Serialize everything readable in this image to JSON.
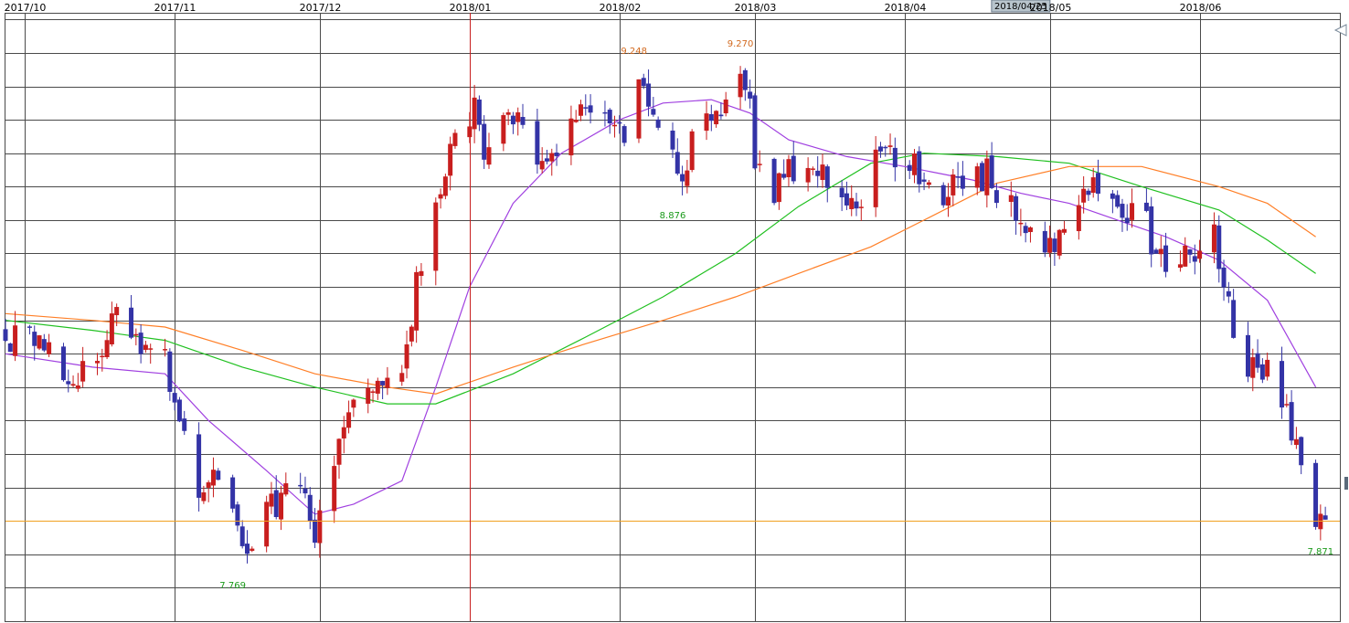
{
  "chart_data": {
    "type": "candlestick",
    "months": [
      {
        "label": "2017/10",
        "date": "2017-10-01"
      },
      {
        "label": "2017/11",
        "date": "2017-11-01"
      },
      {
        "label": "2017/12",
        "date": "2017-12-01"
      },
      {
        "label": "2018/01",
        "date": "2018-01-01"
      },
      {
        "label": "2018/02",
        "date": "2018-02-01"
      },
      {
        "label": "2018/03",
        "date": "2018-03-01"
      },
      {
        "label": "2018/04",
        "date": "2018-04-01"
      },
      {
        "label": "2018/05",
        "date": "2018-05-01"
      },
      {
        "label": "2018/06",
        "date": "2018-06-01"
      }
    ],
    "cursor_date_label": "2018/04/25",
    "x_range": [
      "2017-09-27",
      "2018-06-30"
    ],
    "y_range": [
      7.6,
      9.42
    ],
    "current_price": 7.9,
    "annotations": [
      {
        "text": "9.248",
        "date": "2018-02-04",
        "value": 9.248,
        "kind": "high"
      },
      {
        "text": "9.270",
        "date": "2018-02-26",
        "value": 9.27,
        "kind": "high"
      },
      {
        "text": "8.876",
        "date": "2018-02-12",
        "value": 8.876,
        "kind": "low"
      },
      {
        "text": "7.769",
        "date": "2017-11-13",
        "value": 7.769,
        "kind": "low"
      },
      {
        "text": "7.871",
        "date": "2018-06-26",
        "value": 7.871,
        "kind": "low"
      }
    ],
    "anchors": [
      [
        "2017-09-27",
        8.46
      ],
      [
        "2017-10-05",
        8.42
      ],
      [
        "2017-10-12",
        8.32
      ],
      [
        "2017-10-17",
        8.43
      ],
      [
        "2017-10-20",
        8.5
      ],
      [
        "2017-10-26",
        8.4
      ],
      [
        "2017-10-30",
        8.38
      ],
      [
        "2017-11-02",
        8.19
      ],
      [
        "2017-11-06",
        8.0
      ],
      [
        "2017-11-09",
        8.03
      ],
      [
        "2017-11-13",
        7.9
      ],
      [
        "2017-11-16",
        7.81
      ],
      [
        "2017-11-20",
        7.93
      ],
      [
        "2017-11-24",
        7.97
      ],
      [
        "2017-11-28",
        7.98
      ],
      [
        "2017-11-30",
        7.87
      ],
      [
        "2017-12-04",
        8.08
      ],
      [
        "2017-12-08",
        8.25
      ],
      [
        "2017-12-13",
        8.34
      ],
      [
        "2017-12-19",
        8.38
      ],
      [
        "2017-12-21",
        8.6
      ],
      [
        "2017-12-26",
        8.87
      ],
      [
        "2017-12-28",
        8.98
      ],
      [
        "2018-01-02",
        9.15
      ],
      [
        "2018-01-04",
        8.98
      ],
      [
        "2018-01-09",
        9.12
      ],
      [
        "2018-01-12",
        9.1
      ],
      [
        "2018-01-15",
        8.94
      ],
      [
        "2018-01-19",
        9.0
      ],
      [
        "2018-01-24",
        9.14
      ],
      [
        "2018-01-30",
        9.13
      ],
      [
        "2018-02-02",
        9.05
      ],
      [
        "2018-02-05",
        9.2
      ],
      [
        "2018-02-08",
        9.1
      ],
      [
        "2018-02-13",
        8.93
      ],
      [
        "2018-02-16",
        9.03
      ],
      [
        "2018-02-21",
        9.12
      ],
      [
        "2018-02-26",
        9.22
      ],
      [
        "2018-02-28",
        9.15
      ],
      [
        "2018-03-01",
        9.0
      ],
      [
        "2018-03-05",
        8.88
      ],
      [
        "2018-03-09",
        8.95
      ],
      [
        "2018-03-14",
        8.98
      ],
      [
        "2018-03-19",
        8.87
      ],
      [
        "2018-03-22",
        8.85
      ],
      [
        "2018-03-27",
        9.0
      ],
      [
        "2018-03-30",
        8.96
      ],
      [
        "2018-04-03",
        8.96
      ],
      [
        "2018-04-06",
        8.88
      ],
      [
        "2018-04-10",
        8.88
      ],
      [
        "2018-04-13",
        8.9
      ],
      [
        "2018-04-18",
        8.94
      ],
      [
        "2018-04-20",
        8.88
      ],
      [
        "2018-04-24",
        8.82
      ],
      [
        "2018-04-27",
        8.74
      ],
      [
        "2018-05-02",
        8.72
      ],
      [
        "2018-05-06",
        8.8
      ],
      [
        "2018-05-09",
        8.9
      ],
      [
        "2018-05-12",
        8.85
      ],
      [
        "2018-05-16",
        8.78
      ],
      [
        "2018-05-20",
        8.83
      ],
      [
        "2018-05-23",
        8.7
      ],
      [
        "2018-05-28",
        8.68
      ],
      [
        "2018-06-04",
        8.75
      ],
      [
        "2018-06-08",
        8.45
      ],
      [
        "2018-06-12",
        8.35
      ],
      [
        "2018-06-17",
        8.32
      ],
      [
        "2018-06-20",
        8.16
      ],
      [
        "2018-06-25",
        7.9
      ],
      [
        "2018-06-27",
        7.92
      ]
    ],
    "moving_averages": [
      {
        "color": "#a040e0",
        "points": [
          [
            "2017-09-27",
            8.4
          ],
          [
            "2017-10-15",
            8.36
          ],
          [
            "2017-10-30",
            8.34
          ],
          [
            "2017-11-08",
            8.2
          ],
          [
            "2017-11-20",
            8.05
          ],
          [
            "2017-11-30",
            7.92
          ],
          [
            "2017-12-08",
            7.95
          ],
          [
            "2017-12-18",
            8.02
          ],
          [
            "2017-12-25",
            8.3
          ],
          [
            "2018-01-01",
            8.6
          ],
          [
            "2018-01-10",
            8.85
          ],
          [
            "2018-01-20",
            9.0
          ],
          [
            "2018-02-01",
            9.1
          ],
          [
            "2018-02-10",
            9.15
          ],
          [
            "2018-02-20",
            9.16
          ],
          [
            "2018-02-28",
            9.12
          ],
          [
            "2018-03-08",
            9.04
          ],
          [
            "2018-03-20",
            8.99
          ],
          [
            "2018-04-01",
            8.96
          ],
          [
            "2018-04-15",
            8.92
          ],
          [
            "2018-04-25",
            8.88
          ],
          [
            "2018-05-05",
            8.85
          ],
          [
            "2018-05-15",
            8.8
          ],
          [
            "2018-05-25",
            8.75
          ],
          [
            "2018-06-05",
            8.68
          ],
          [
            "2018-06-15",
            8.56
          ],
          [
            "2018-06-25",
            8.3
          ]
        ]
      },
      {
        "color": "#20c020",
        "points": [
          [
            "2017-09-27",
            8.5
          ],
          [
            "2017-10-15",
            8.47
          ],
          [
            "2017-10-30",
            8.44
          ],
          [
            "2017-11-15",
            8.36
          ],
          [
            "2017-11-30",
            8.3
          ],
          [
            "2017-12-15",
            8.25
          ],
          [
            "2017-12-25",
            8.25
          ],
          [
            "2018-01-10",
            8.34
          ],
          [
            "2018-01-25",
            8.45
          ],
          [
            "2018-02-10",
            8.57
          ],
          [
            "2018-02-25",
            8.7
          ],
          [
            "2018-03-10",
            8.84
          ],
          [
            "2018-03-25",
            8.97
          ],
          [
            "2018-04-05",
            9.0
          ],
          [
            "2018-04-20",
            8.99
          ],
          [
            "2018-05-05",
            8.97
          ],
          [
            "2018-05-20",
            8.9
          ],
          [
            "2018-06-05",
            8.83
          ],
          [
            "2018-06-15",
            8.74
          ],
          [
            "2018-06-25",
            8.64
          ]
        ]
      },
      {
        "color": "#ff7f27",
        "points": [
          [
            "2017-09-27",
            8.52
          ],
          [
            "2017-10-15",
            8.5
          ],
          [
            "2017-10-30",
            8.48
          ],
          [
            "2017-11-15",
            8.41
          ],
          [
            "2017-11-30",
            8.34
          ],
          [
            "2017-12-15",
            8.3
          ],
          [
            "2017-12-25",
            8.28
          ],
          [
            "2018-01-10",
            8.36
          ],
          [
            "2018-01-25",
            8.43
          ],
          [
            "2018-02-10",
            8.5
          ],
          [
            "2018-02-25",
            8.57
          ],
          [
            "2018-03-10",
            8.64
          ],
          [
            "2018-03-25",
            8.72
          ],
          [
            "2018-04-05",
            8.8
          ],
          [
            "2018-04-20",
            8.91
          ],
          [
            "2018-05-05",
            8.96
          ],
          [
            "2018-05-20",
            8.96
          ],
          [
            "2018-06-05",
            8.9
          ],
          [
            "2018-06-15",
            8.85
          ],
          [
            "2018-06-25",
            8.75
          ]
        ]
      }
    ],
    "colors": {
      "up": "#c81e1e",
      "down": "#3333a6",
      "grid": "#4a4a4a",
      "price_line": "#f0a020",
      "cursor_line": "#c81e1e",
      "high_label": "#d2691e",
      "low_label": "#1a9a1a",
      "cursor_label_bg": "#b8c4cc"
    }
  }
}
